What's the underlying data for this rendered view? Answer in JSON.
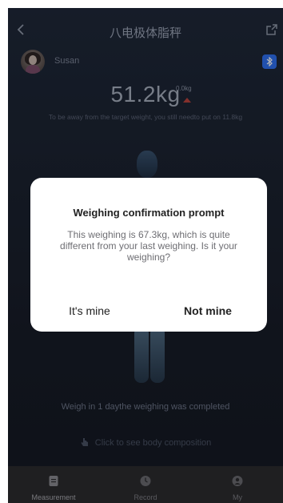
{
  "header": {
    "title": "八电极体脂秤"
  },
  "user": {
    "name": "Susan"
  },
  "weight": {
    "value": "51.2kg",
    "delta": "0.0kg",
    "target_text": "To be away from the target weight, you still needto put on 11.8kg"
  },
  "status": {
    "weigh_text": "Weigh in 1 daythe weighing was completed",
    "body_composition_link": "Click to see body composition"
  },
  "nav": {
    "items": [
      {
        "label": "Measurement",
        "icon": "clipboard-icon",
        "active": true
      },
      {
        "label": "Record",
        "icon": "clock-icon",
        "active": false
      },
      {
        "label": "My",
        "icon": "person-icon",
        "active": false
      }
    ]
  },
  "dialog": {
    "title": "Weighing confirmation prompt",
    "message": "This weighing is 67.3kg, which is quite different from your last weighing. Is it your weighing?",
    "left_button": "It's mine",
    "right_button": "Not mine"
  },
  "colors": {
    "accent_blue": "#2f6ff0",
    "delta_red": "#b8433e",
    "background_dark": "#1d2330"
  }
}
